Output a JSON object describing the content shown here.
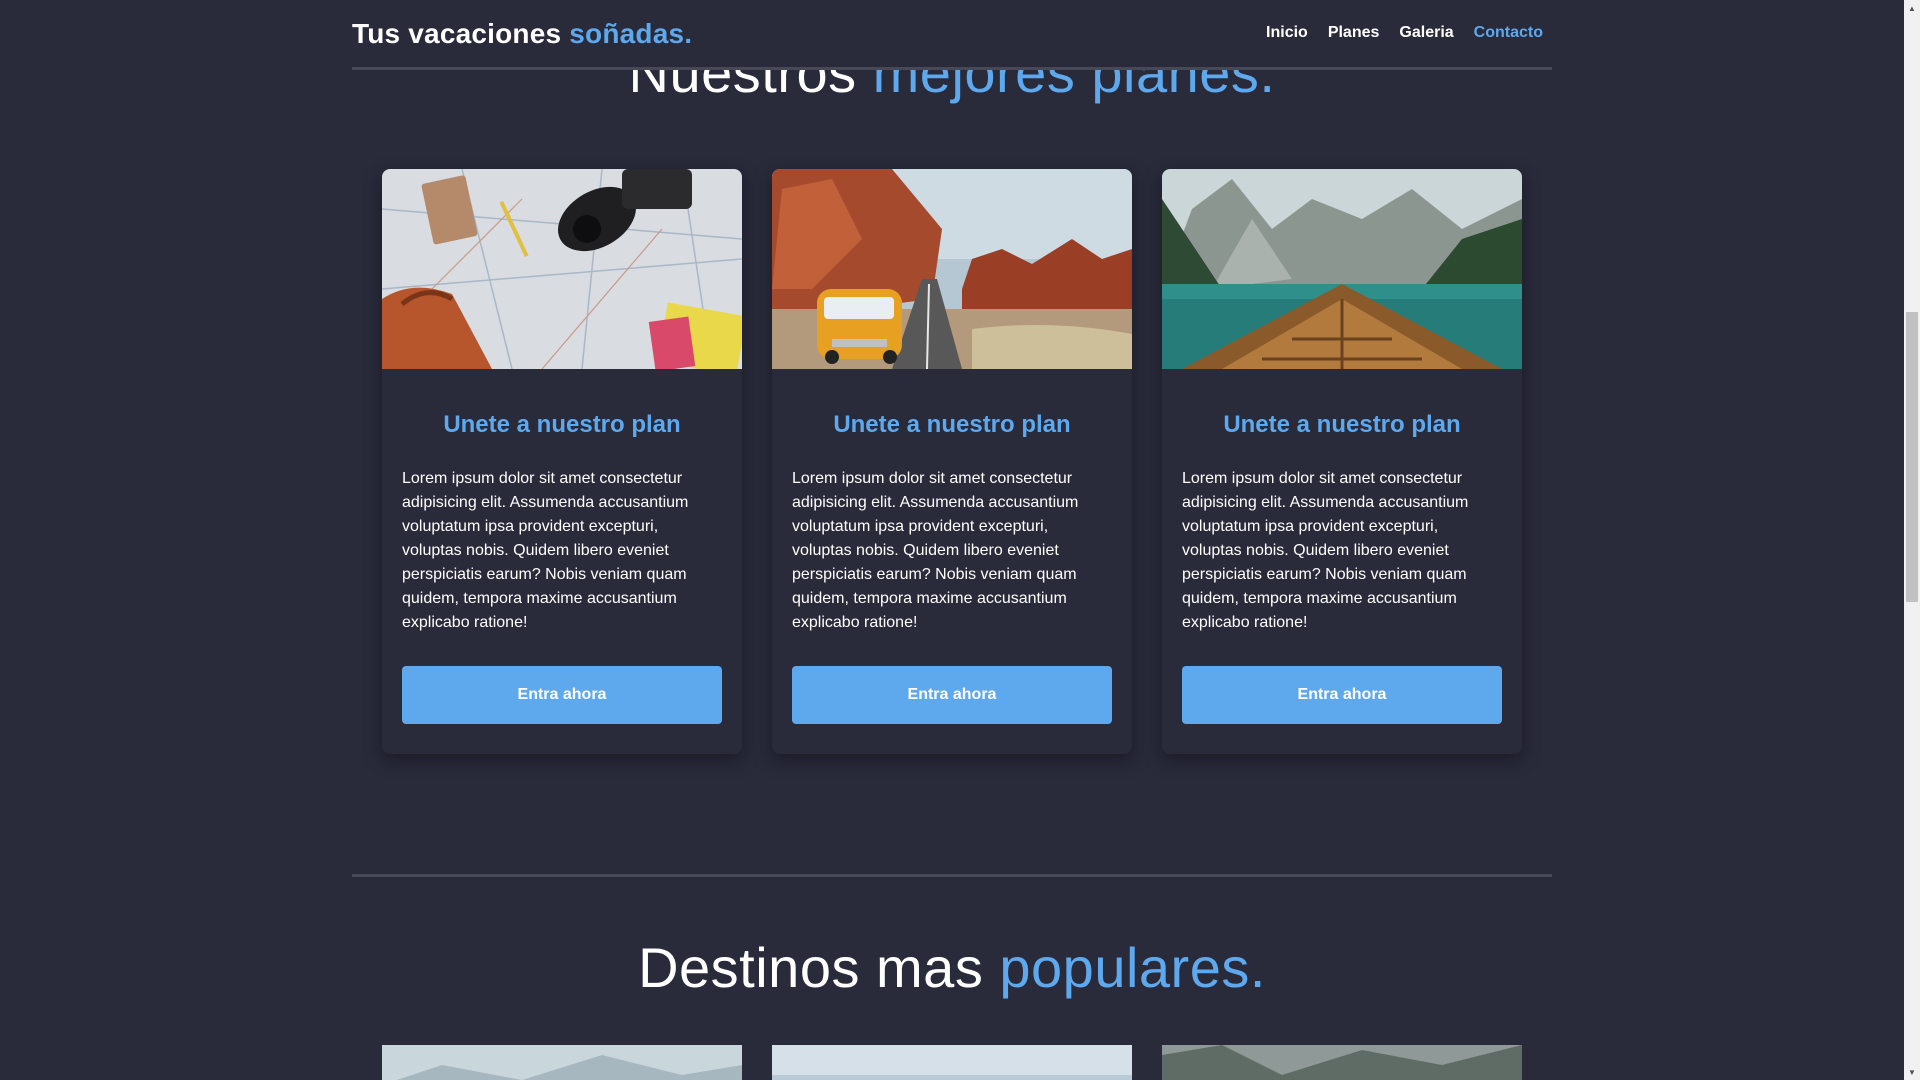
{
  "header": {
    "brand_main": "Tus vacaciones ",
    "brand_accent": "soñadas.",
    "nav": [
      {
        "label": "Inicio",
        "active": false
      },
      {
        "label": "Planes",
        "active": false
      },
      {
        "label": "Galeria",
        "active": false
      },
      {
        "label": "Contacto",
        "active": true
      }
    ]
  },
  "planes_section": {
    "title_main": "Nuestros ",
    "title_accent": "mejores planes."
  },
  "cards": [
    {
      "image": "travel-map-camera-backpack-photo",
      "title": "Unete a nuestro plan",
      "text": "Lorem ipsum dolor sit amet consectetur adipisicing elit. Assumenda accusantium voluptatum ipsa provident excepturi, voluptas nobis. Quidem libero eveniet perspiciatis earum? Nobis veniam quam quidem, tempora maxime accusantium explicabo ratione!",
      "button": "Entra ahora"
    },
    {
      "image": "desert-road-van-photo",
      "title": "Unete a nuestro plan",
      "text": "Lorem ipsum dolor sit amet consectetur adipisicing elit. Assumenda accusantium voluptatum ipsa provident excepturi, voluptas nobis. Quidem libero eveniet perspiciatis earum? Nobis veniam quam quidem, tempora maxime accusantium explicabo ratione!",
      "button": "Entra ahora"
    },
    {
      "image": "mountain-lake-boat-photo",
      "title": "Unete a nuestro plan",
      "text": "Lorem ipsum dolor sit amet consectetur adipisicing elit. Assumenda accusantium voluptatum ipsa provident excepturi, voluptas nobis. Quidem libero eveniet perspiciatis earum? Nobis veniam quam quidem, tempora maxime accusantium explicabo ratione!",
      "button": "Entra ahora"
    }
  ],
  "destinos_section": {
    "title_main": "Destinos mas ",
    "title_accent": "populares."
  },
  "colors": {
    "background": "#292a3a",
    "accent": "#5ea9ee",
    "divider": "#474957"
  }
}
